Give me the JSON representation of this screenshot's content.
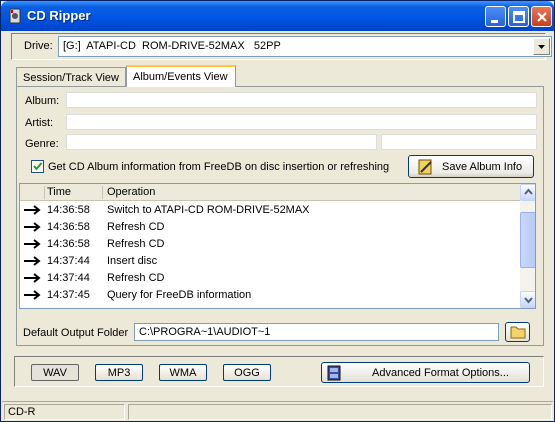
{
  "window": {
    "title": "CD Ripper"
  },
  "drive": {
    "label": "Drive:",
    "selected": "[G:]  ATAPI-CD  ROM-DRIVE-52MAX   52PP"
  },
  "tabs": [
    {
      "label": "Session/Track View",
      "active": false
    },
    {
      "label": "Album/Events View",
      "active": true
    }
  ],
  "album_fields": {
    "album_label": "Album:",
    "artist_label": "Artist:",
    "genre_label": "Genre:",
    "album_value": "",
    "artist_value": "",
    "genre_value": "",
    "genre_extra_value": ""
  },
  "freedb": {
    "checkbox_label": "Get CD Album information from FreeDB on disc insertion or refreshing",
    "checked": true,
    "save_button": "Save Album Info"
  },
  "log": {
    "columns": [
      "Time",
      "Operation"
    ],
    "rows": [
      {
        "time": "14:36:58",
        "operation": "Switch to ATAPI-CD ROM-DRIVE-52MAX"
      },
      {
        "time": "14:36:58",
        "operation": "Refresh CD"
      },
      {
        "time": "14:36:58",
        "operation": "Refresh CD"
      },
      {
        "time": "14:37:44",
        "operation": "Insert disc"
      },
      {
        "time": "14:37:44",
        "operation": "Refresh CD"
      },
      {
        "time": "14:37:45",
        "operation": "Query for FreeDB information"
      }
    ]
  },
  "output": {
    "label": "Default Output Folder",
    "path": "C:\\PROGRA~1\\AUDIOT~1"
  },
  "formats": {
    "buttons": [
      "WAV",
      "MP3",
      "WMA",
      "OGG"
    ],
    "selected": "WAV",
    "advanced_button": "Advanced Format Options..."
  },
  "status": {
    "left": "CD-R",
    "right": ""
  },
  "colors": {
    "title_bar": "#0054e3",
    "window_bg": "#ece9d8",
    "accent_tab": "#ffc83c"
  }
}
